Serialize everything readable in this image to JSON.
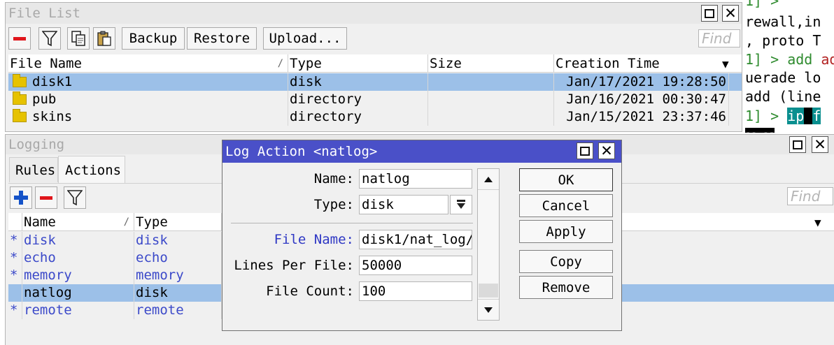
{
  "terminal": {
    "lines": [
      "1] > ",
      "rewall,in",
      ", proto T",
      "1] > add ",
      "uerade lo",
      "add (line",
      "1] > ",
      "-- --"
    ],
    "add_word": "add",
    "ip_cmd": "ip",
    "f_cmd": "f"
  },
  "file_list": {
    "title": "File List",
    "toolbar": {
      "backup": "Backup",
      "restore": "Restore",
      "upload": "Upload..."
    },
    "find_placeholder": "Find",
    "columns": {
      "name": "File Name",
      "type": "Type",
      "size": "Size",
      "created": "Creation Time"
    },
    "rows": [
      {
        "name": "disk1",
        "type": "disk",
        "size": "",
        "created": "Jan/17/2021 19:28:50",
        "selected": true
      },
      {
        "name": "pub",
        "type": "directory",
        "size": "",
        "created": "Jan/16/2021 00:30:47",
        "selected": false
      },
      {
        "name": "skins",
        "type": "directory",
        "size": "",
        "created": "Jan/15/2021 23:37:46",
        "selected": false
      }
    ]
  },
  "logging": {
    "title": "Logging",
    "tabs": [
      "Rules",
      "Actions"
    ],
    "active_tab": "Actions",
    "find_placeholder": "Find",
    "columns": {
      "name": "Name",
      "type": "Type"
    },
    "rows": [
      {
        "mark": "*",
        "name": "disk",
        "type": "disk",
        "default": true,
        "selected": false
      },
      {
        "mark": "*",
        "name": "echo",
        "type": "echo",
        "default": true,
        "selected": false
      },
      {
        "mark": "*",
        "name": "memory",
        "type": "memory",
        "default": true,
        "selected": false
      },
      {
        "mark": "",
        "name": "natlog",
        "type": "disk",
        "default": false,
        "selected": true
      },
      {
        "mark": "*",
        "name": "remote",
        "type": "remote",
        "default": true,
        "selected": false
      }
    ]
  },
  "dialog": {
    "title": "Log Action <natlog>",
    "fields": {
      "name_label": "Name:",
      "name_value": "natlog",
      "type_label": "Type:",
      "type_value": "disk",
      "file_name_label": "File Name:",
      "file_name_value": "disk1/nat_log/",
      "lines_label": "Lines Per File:",
      "lines_value": "50000",
      "count_label": "File Count:",
      "count_value": "100"
    },
    "buttons": {
      "ok": "OK",
      "cancel": "Cancel",
      "apply": "Apply",
      "copy": "Copy",
      "remove": "Remove"
    }
  },
  "colors": {
    "selection": "#9cc0e8",
    "dialog_title": "#4a50c8",
    "link_blue": "#3b49c9",
    "remove_red": "#e0161c",
    "add_blue": "#1452c8"
  }
}
